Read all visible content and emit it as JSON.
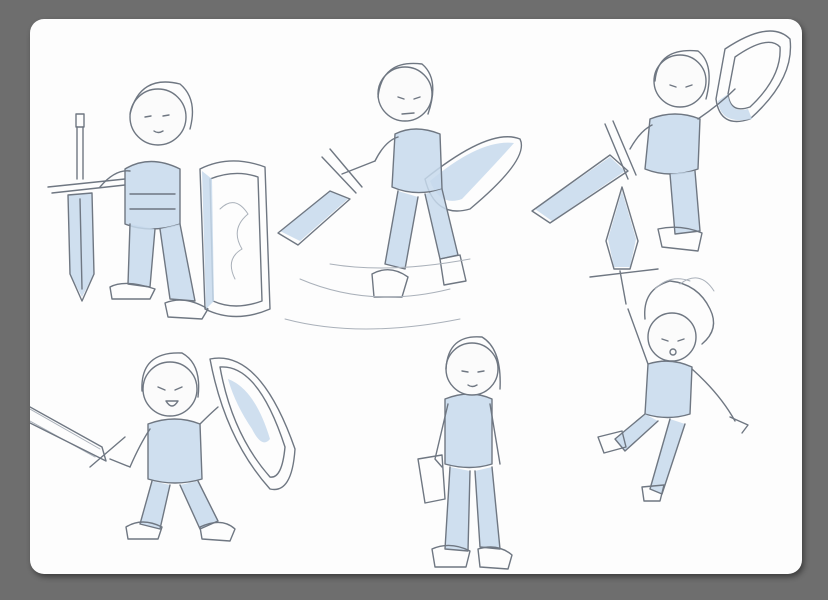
{
  "sheet": {
    "background": "#6e6e6e",
    "paper_color": "#fdfdfd",
    "pencil_color": "#6f7782",
    "shading_color": "#c7d9ec"
  },
  "figures": [
    {
      "pose": "standing-sword-down-shield-right"
    },
    {
      "pose": "lunging-sword-forward-surfboard-shield"
    },
    {
      "pose": "leaning-sword-thrust-shield-raised"
    },
    {
      "pose": "battle-cry-sword-left-shield"
    },
    {
      "pose": "standing-calm-arms-down"
    },
    {
      "pose": "jumping-sword-overhead-hair-flying"
    }
  ]
}
